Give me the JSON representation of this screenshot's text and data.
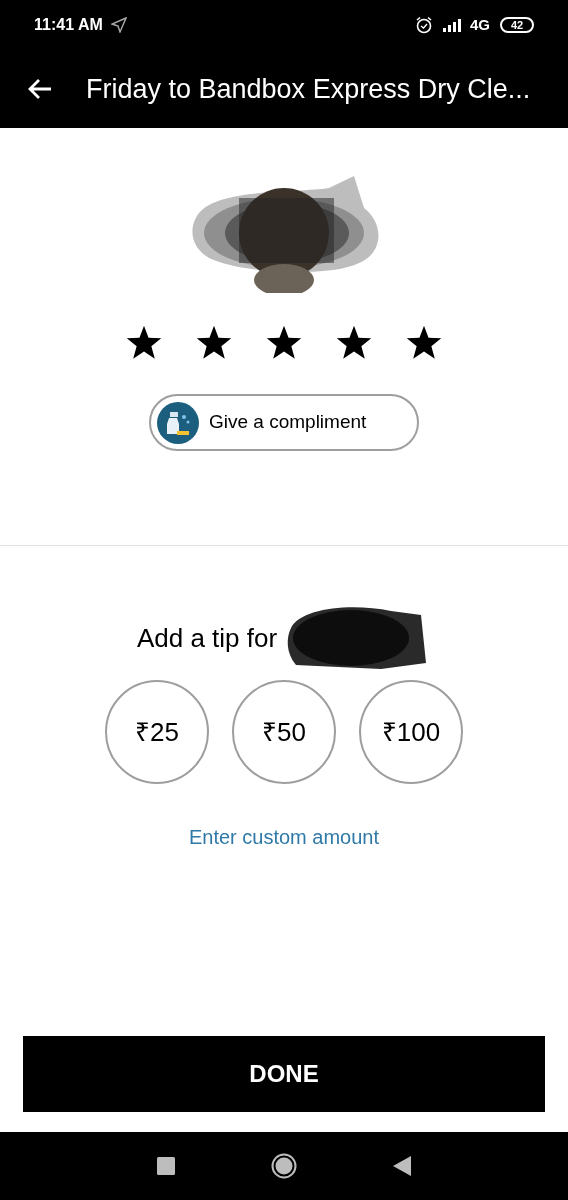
{
  "status_bar": {
    "time": "11:41 AM",
    "network": "4G",
    "battery": "42"
  },
  "header": {
    "title": "Friday to Bandbox Express Dry Cle..."
  },
  "rating": {
    "stars": 5
  },
  "compliment_button": {
    "label": "Give a compliment"
  },
  "tip": {
    "title": "Add a tip for",
    "options": [
      {
        "label": "₹25",
        "selected": false
      },
      {
        "label": "₹50",
        "selected": false
      },
      {
        "label": "₹100",
        "selected": false
      }
    ],
    "custom_link": "Enter custom amount"
  },
  "done_button": {
    "label": "DONE"
  }
}
